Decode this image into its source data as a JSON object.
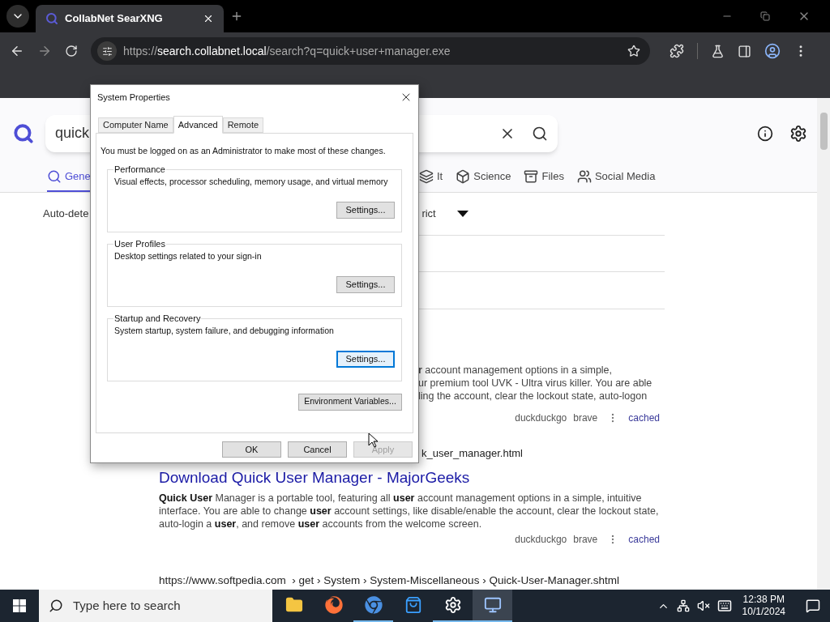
{
  "browser": {
    "tab_title": "CollabNet SearXNG",
    "url_host": "https://search.collabnet.local",
    "url_path": "/search?q=quick+user+manager.exe"
  },
  "page": {
    "search": {
      "value": "quick"
    },
    "categories": [
      {
        "kind": "search",
        "label": "Gene",
        "selected": true
      },
      {
        "kind": "layers",
        "label": "It",
        "selected": false
      },
      {
        "kind": "science",
        "label": "Science",
        "selected": false
      },
      {
        "kind": "files",
        "label": "Files",
        "selected": false
      },
      {
        "kind": "social",
        "label": "Social Media",
        "selected": false
      }
    ],
    "language": "Auto-dete",
    "safe_search": "rict",
    "results": [
      {
        "snippet_lines": [
          "**r** account management options in a simple,",
          "ur premium tool UVK - Ultra virus killer. You are able",
          "ling the account, clear the lockout state, auto-logon"
        ],
        "engines": [
          "duckduckgo",
          "brave"
        ],
        "cached": "cached"
      },
      {
        "url": "k_user_manager.html",
        "title": "Download Quick User Manager - MajorGeeks",
        "snippet": "**Quick User** Manager is a portable tool, featuring all **user** account management options in a simple, intuitive interface. You are able to change **user** account settings, like disable/enable the account, clear the lockout state, auto-login a **user**, and remove **user** accounts from the welcome screen.",
        "engines": [
          "duckduckgo",
          "brave"
        ],
        "cached": "cached"
      },
      {
        "url": "https://www.softpedia.com  › get › System › System-Miscellaneous › Quick-User-Manager.shtml"
      }
    ]
  },
  "dialog": {
    "title": "System Properties",
    "tabs": [
      {
        "label": "Computer Name",
        "selected": false
      },
      {
        "label": "Advanced",
        "selected": true
      },
      {
        "label": "Remote",
        "selected": false
      }
    ],
    "notice": "You must be logged on as an Administrator to make most of these changes.",
    "groups": [
      {
        "title": "Performance",
        "description": "Visual effects, processor scheduling, memory usage, and virtual memory",
        "button": "Settings...",
        "focused": false
      },
      {
        "title": "User Profiles",
        "description": "Desktop settings related to your sign-in",
        "button": "Settings...",
        "focused": false
      },
      {
        "title": "Startup and Recovery",
        "description": "System startup, system failure, and debugging information",
        "button": "Settings...",
        "focused": true
      }
    ],
    "env_button": "Environment Variables...",
    "buttons": [
      {
        "label": "OK",
        "disabled": false
      },
      {
        "label": "Cancel",
        "disabled": false
      },
      {
        "label": "Apply",
        "disabled": true
      }
    ]
  },
  "taskbar": {
    "search_placeholder": "Type here to search",
    "apps": [
      {
        "kind": "explorer",
        "active": false,
        "focused": false
      },
      {
        "kind": "firefox",
        "active": false,
        "focused": false
      },
      {
        "kind": "chrome",
        "active": true,
        "focused": false
      },
      {
        "kind": "store",
        "active": false,
        "focused": false
      },
      {
        "kind": "settings",
        "active": true,
        "focused": false
      },
      {
        "kind": "system",
        "active": true,
        "focused": true
      }
    ],
    "time": "12:38 PM",
    "date": "10/1/2024"
  }
}
